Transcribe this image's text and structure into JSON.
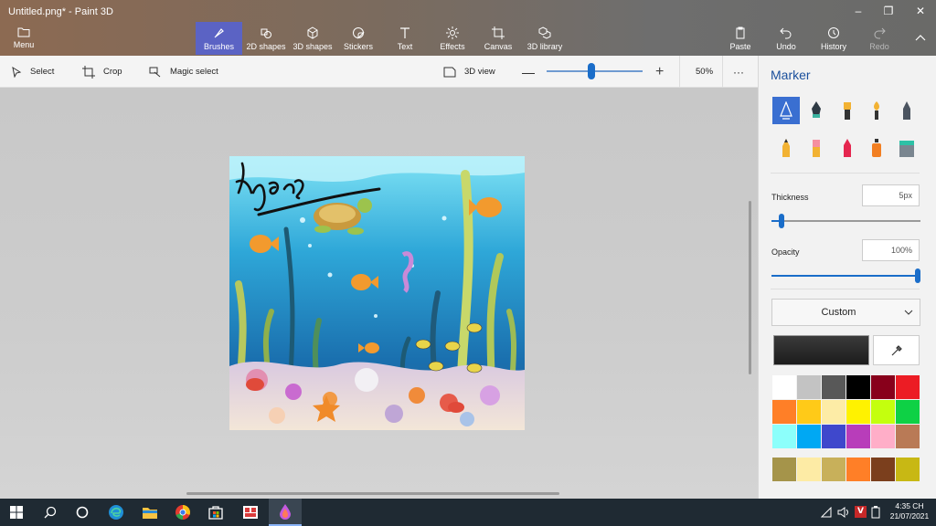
{
  "app": {
    "title": "Untitled.png* - Paint 3D"
  },
  "menu_label": "Menu",
  "tabs": [
    {
      "label": "Brushes",
      "icon": "brush-icon"
    },
    {
      "label": "2D shapes",
      "icon": "2d-shapes-icon"
    },
    {
      "label": "3D shapes",
      "icon": "3d-shapes-icon"
    },
    {
      "label": "Stickers",
      "icon": "stickers-icon"
    },
    {
      "label": "Text",
      "icon": "text-icon"
    },
    {
      "label": "Effects",
      "icon": "effects-icon"
    },
    {
      "label": "Canvas",
      "icon": "canvas-icon"
    },
    {
      "label": "3D library",
      "icon": "3d-library-icon"
    }
  ],
  "actions": {
    "paste": "Paste",
    "undo": "Undo",
    "history": "History",
    "redo": "Redo"
  },
  "toolbar": {
    "select": "Select",
    "crop": "Crop",
    "magic_select": "Magic select",
    "view3d": "3D view",
    "zoom": "50%",
    "zoom_fraction": 0.45
  },
  "canvas": {
    "signature_text": "ngas"
  },
  "panel": {
    "title": "Marker",
    "brushes": [
      "marker-icon",
      "calligraphy-pen-icon",
      "oil-brush-icon",
      "watercolor-icon",
      "pixel-pen-icon",
      "pencil-icon",
      "eraser-icon",
      "crayon-icon",
      "spray-can-icon",
      "fill-icon"
    ],
    "thickness_label": "Thickness",
    "thickness_value": "5px",
    "thickness_fraction": 0.05,
    "opacity_label": "Opacity",
    "opacity_value": "100%",
    "opacity_fraction": 1.0,
    "color_mode": "Custom",
    "current_color": "#1c1c1c",
    "palette": [
      "#ffffff",
      "#c3c3c3",
      "#585858",
      "#000000",
      "#88001b",
      "#ec1c24",
      "#ff7f27",
      "#ffca18",
      "#fdeca6",
      "#fff200",
      "#c4ff0e",
      "#0ed145",
      "#8cfffb",
      "#00a8f3",
      "#3f48cc",
      "#b83dba",
      "#ffaec8",
      "#b97a56"
    ],
    "custom_colors": [
      "#a5944a",
      "#fdeba5",
      "#c8b05a",
      "#ff7f27",
      "#7b3f1d",
      "#c8b814"
    ]
  },
  "taskbar": {
    "time": "4:35 CH",
    "date": "21/07/2021"
  }
}
